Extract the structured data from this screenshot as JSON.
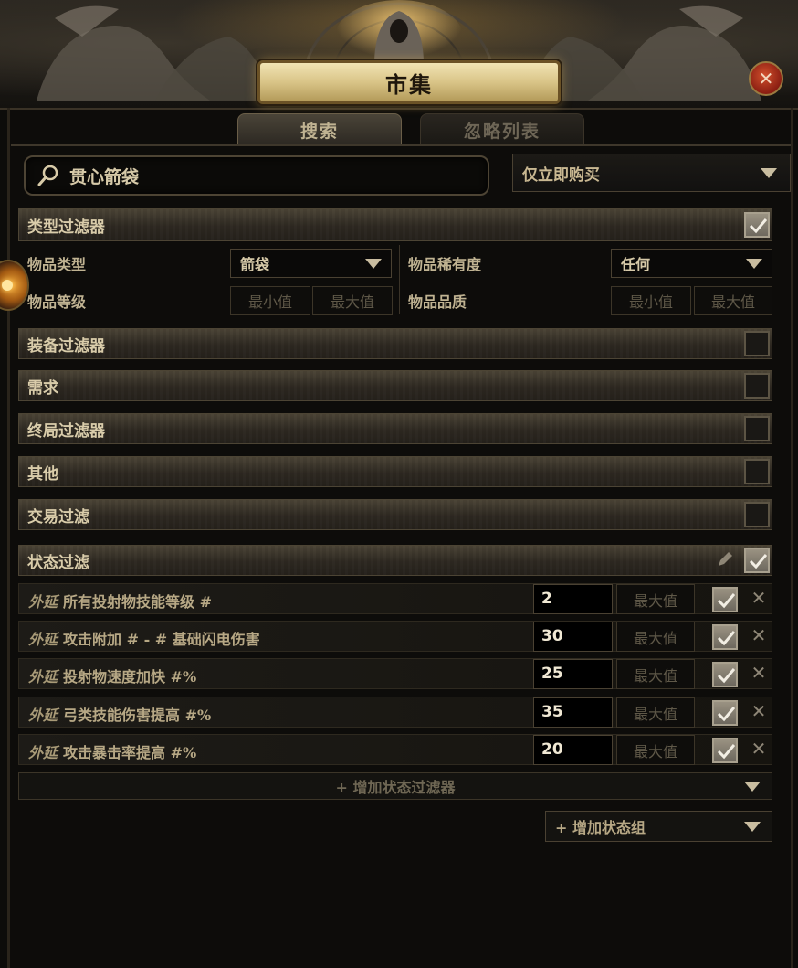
{
  "window": {
    "title": "市集",
    "close_icon": "close-icon"
  },
  "tabs": [
    {
      "label": "搜索",
      "active": true
    },
    {
      "label": "忽略列表",
      "active": false
    }
  ],
  "search": {
    "value": "贯心箭袋",
    "icon": "search-icon"
  },
  "buy_mode": {
    "selected": "仅立即购买"
  },
  "type_filters": {
    "label": "类型过滤器",
    "checked": true,
    "item_type_label": "物品类型",
    "item_type_value": "箭袋",
    "rarity_label": "物品稀有度",
    "rarity_value": "任何",
    "item_level_label": "物品等级",
    "item_level_min": "最小值",
    "item_level_max": "最大值",
    "quality_label": "物品品质",
    "quality_min": "最小值",
    "quality_max": "最大值"
  },
  "filter_groups": [
    {
      "label": "装备过滤器",
      "checked": false
    },
    {
      "label": "需求",
      "checked": false
    },
    {
      "label": "终局过滤器",
      "checked": false
    },
    {
      "label": "其他",
      "checked": false
    },
    {
      "label": "交易过滤",
      "checked": false
    }
  ],
  "stat_filters": {
    "label": "状态过滤",
    "checked": true,
    "rows": [
      {
        "prefix": "外延",
        "text": "所有投射物技能等级 #",
        "min": "2",
        "max": "最大值",
        "checked": true
      },
      {
        "prefix": "外延",
        "text": "攻击附加 # - # 基础闪电伤害",
        "min": "30",
        "max": "最大值",
        "checked": true
      },
      {
        "prefix": "外延",
        "text": "投射物速度加快 #%",
        "min": "25",
        "max": "最大值",
        "checked": true
      },
      {
        "prefix": "外延",
        "text": "弓类技能伤害提高 #%",
        "min": "35",
        "max": "最大值",
        "checked": true
      },
      {
        "prefix": "外延",
        "text": "攻击暴击率提高 #%",
        "min": "20",
        "max": "最大值",
        "checked": true
      }
    ],
    "add_filter_label": "+ 增加状态过滤器"
  },
  "add_group_label": "+ 增加状态组",
  "colors": {
    "accent": "#c9b892",
    "close": "#b83a20",
    "panel": "#2d2821"
  }
}
